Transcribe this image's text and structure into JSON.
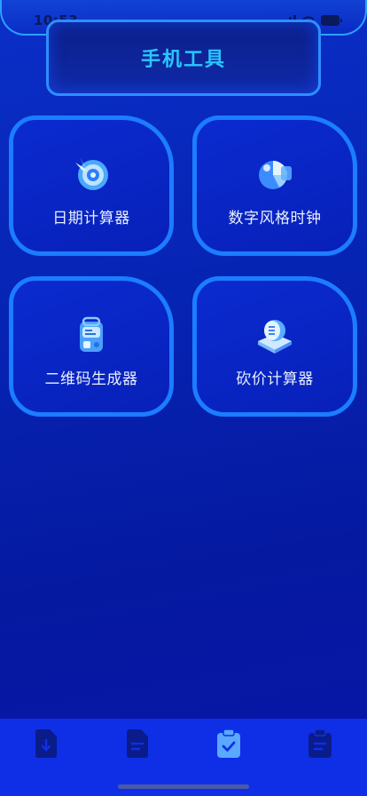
{
  "status": {
    "time": "10:53"
  },
  "header": {
    "title": "手机工具"
  },
  "tools": [
    {
      "label": "日期计算器",
      "icon": "target-dart-icon"
    },
    {
      "label": "数字风格时钟",
      "icon": "pie-chart-icon"
    },
    {
      "label": "二维码生成器",
      "icon": "backpack-icon"
    },
    {
      "label": "砍价计算器",
      "icon": "coin-stack-icon"
    }
  ],
  "tabs": [
    {
      "icon": "download-document-icon",
      "active": false
    },
    {
      "icon": "text-document-icon",
      "active": false
    },
    {
      "icon": "clipboard-check-icon",
      "active": true
    },
    {
      "icon": "clipboard-list-icon",
      "active": false
    }
  ],
  "colors": {
    "accent": "#29c6ff",
    "border": "#1b7dff",
    "tab_bar": "#0f2fe6",
    "tab_inactive": "#0a1c8a",
    "tab_active": "#5aa8ff"
  }
}
